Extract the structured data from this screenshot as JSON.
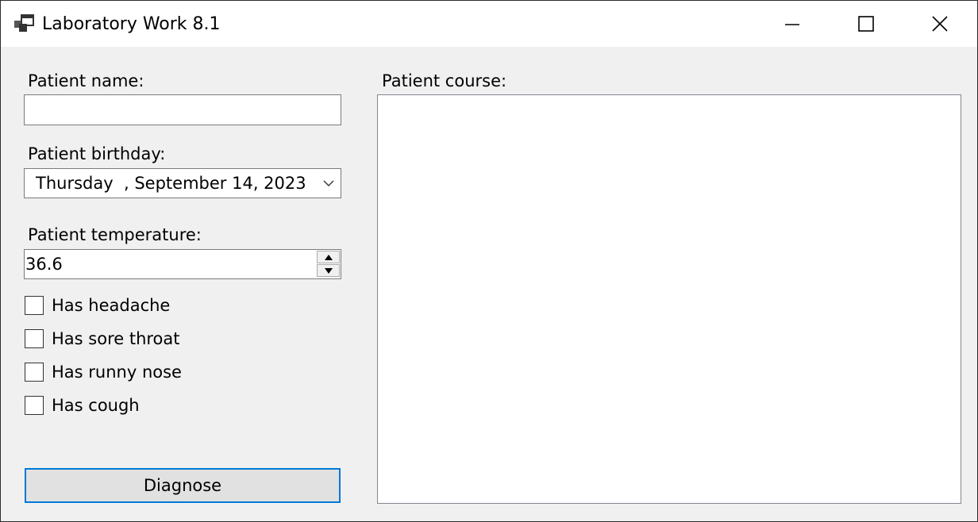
{
  "window": {
    "title": "Laboratory Work 8.1",
    "app_icon": "app-window-icon",
    "controls": [
      "minimize-icon",
      "maximize-icon",
      "close-icon"
    ]
  },
  "form": {
    "name_label": "Patient name:",
    "name_value": "",
    "birthday_label": "Patient birthday:",
    "birthday_value": "Thursday  , September 14, 2023",
    "temperature_label": "Patient temperature:",
    "temperature_value": "36.6",
    "checkboxes": [
      {
        "label": "Has headache",
        "checked": false
      },
      {
        "label": "Has sore throat",
        "checked": false
      },
      {
        "label": "Has runny nose",
        "checked": false
      },
      {
        "label": "Has cough",
        "checked": false
      }
    ],
    "diagnose_label": "Diagnose",
    "course_label": "Patient course:",
    "course_value": ""
  },
  "colors": {
    "accent": "#0078d7",
    "window_bg": "#f0f0f0",
    "titlebar_bg": "#ffffff"
  }
}
